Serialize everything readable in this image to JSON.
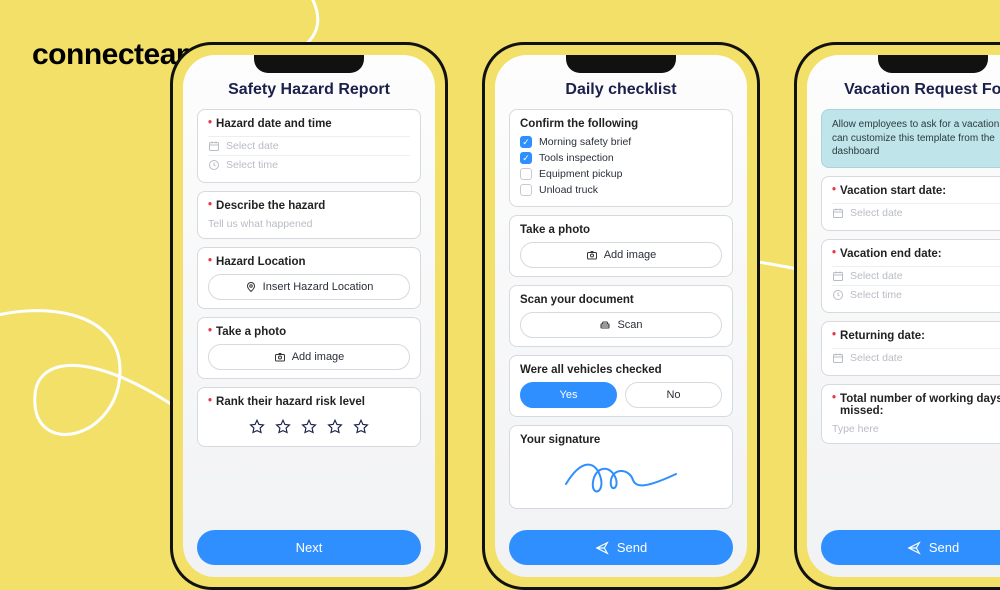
{
  "brand": {
    "logo_text": "connecteam"
  },
  "colors": {
    "accent": "#2f8fff",
    "bg": "#f2e069",
    "text_dark": "#1a1f4b",
    "danger": "#e63946"
  },
  "phones": {
    "safety": {
      "title": "Safety Hazard Report",
      "datetime": {
        "label": "Hazard date and time",
        "date_placeholder": "Select date",
        "time_placeholder": "Select time"
      },
      "describe": {
        "label": "Describe the hazard",
        "placeholder": "Tell us what happened"
      },
      "location": {
        "label": "Hazard Location",
        "placeholder": "Insert Hazard Location"
      },
      "photo": {
        "label": "Take a photo",
        "button": "Add image"
      },
      "rank": {
        "label": "Rank their hazard risk level"
      },
      "cta": "Next"
    },
    "checklist": {
      "title": "Daily checklist",
      "confirm": {
        "label": "Confirm the following",
        "items": [
          {
            "label": "Morning safety brief",
            "checked": true
          },
          {
            "label": "Tools inspection",
            "checked": true
          },
          {
            "label": "Equipment pickup",
            "checked": false
          },
          {
            "label": "Unload truck",
            "checked": false
          }
        ]
      },
      "photo": {
        "label": "Take a photo",
        "button": "Add image"
      },
      "scan": {
        "label": "Scan your document",
        "button": "Scan"
      },
      "vehicles": {
        "label": "Were all vehicles checked",
        "yes": "Yes",
        "no": "No",
        "selected": "yes"
      },
      "signature": {
        "label": "Your signature"
      },
      "cta": "Send"
    },
    "vacation": {
      "title": "Vacation Request Form",
      "info": "Allow employees to ask for a vacation. You can customize this template from the dashboard",
      "start": {
        "label": "Vacation start date:",
        "date_placeholder": "Select date"
      },
      "end": {
        "label": "Vacation end date:",
        "date_placeholder": "Select date",
        "time_placeholder": "Select time"
      },
      "returning": {
        "label": "Returning date:",
        "date_placeholder": "Select date"
      },
      "days": {
        "label": "Total number of working days missed:",
        "placeholder": "Type here"
      },
      "cta": "Send"
    }
  }
}
